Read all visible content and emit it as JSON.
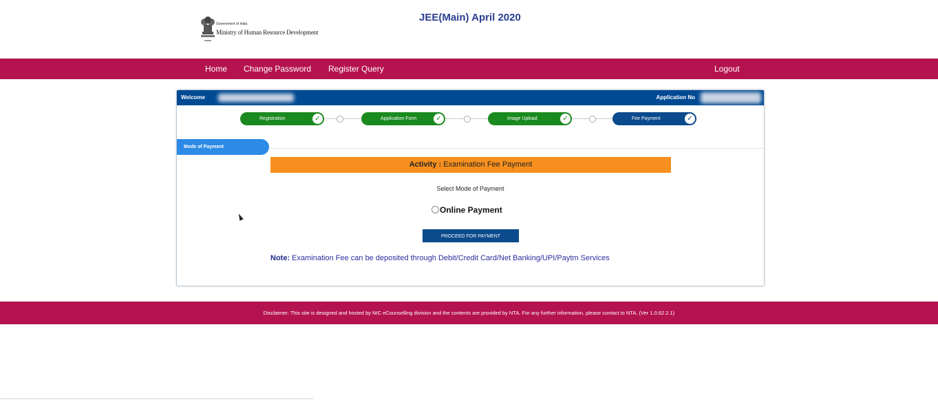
{
  "header": {
    "gov_text": "Government of India",
    "ministry": "Ministry of Human Resource Development",
    "title": "JEE(Main) April 2020"
  },
  "nav": {
    "items": [
      "Home",
      "Change Password",
      "Register Query"
    ],
    "logout": "Logout"
  },
  "welcome": {
    "label": "Welcome",
    "application_no_label": "Application No"
  },
  "steps": [
    {
      "label": "Registration",
      "status": "done"
    },
    {
      "label": "Application Form",
      "status": "done"
    },
    {
      "label": "Image Upload",
      "status": "done"
    },
    {
      "label": "Fee Payment",
      "status": "current"
    }
  ],
  "mode_tab": "Mode of Payment",
  "activity": {
    "label": "Activity :",
    "value": "Examination Fee Payment"
  },
  "select_mode": "Select Mode of Payment",
  "payment_option": "Online Payment",
  "proceed_button": "PROCEED FOR PAYMENT",
  "note": {
    "label": "Note:",
    "text": "Examination Fee can be deposited through Debit/Credit Card/Net Banking/UPI/Paytm Services"
  },
  "footer": "Disclaimer: This site is designed and hosted by NIC eCounselling division and the contents are provided by NTA. For any further information, please contact to NTA. (Ver 1.0.62.2.1)",
  "colors": {
    "nav_bg": "#b5134f",
    "blue": "#004a93",
    "step_done": "#1a8a1f",
    "activity_bg": "#f7901e"
  }
}
